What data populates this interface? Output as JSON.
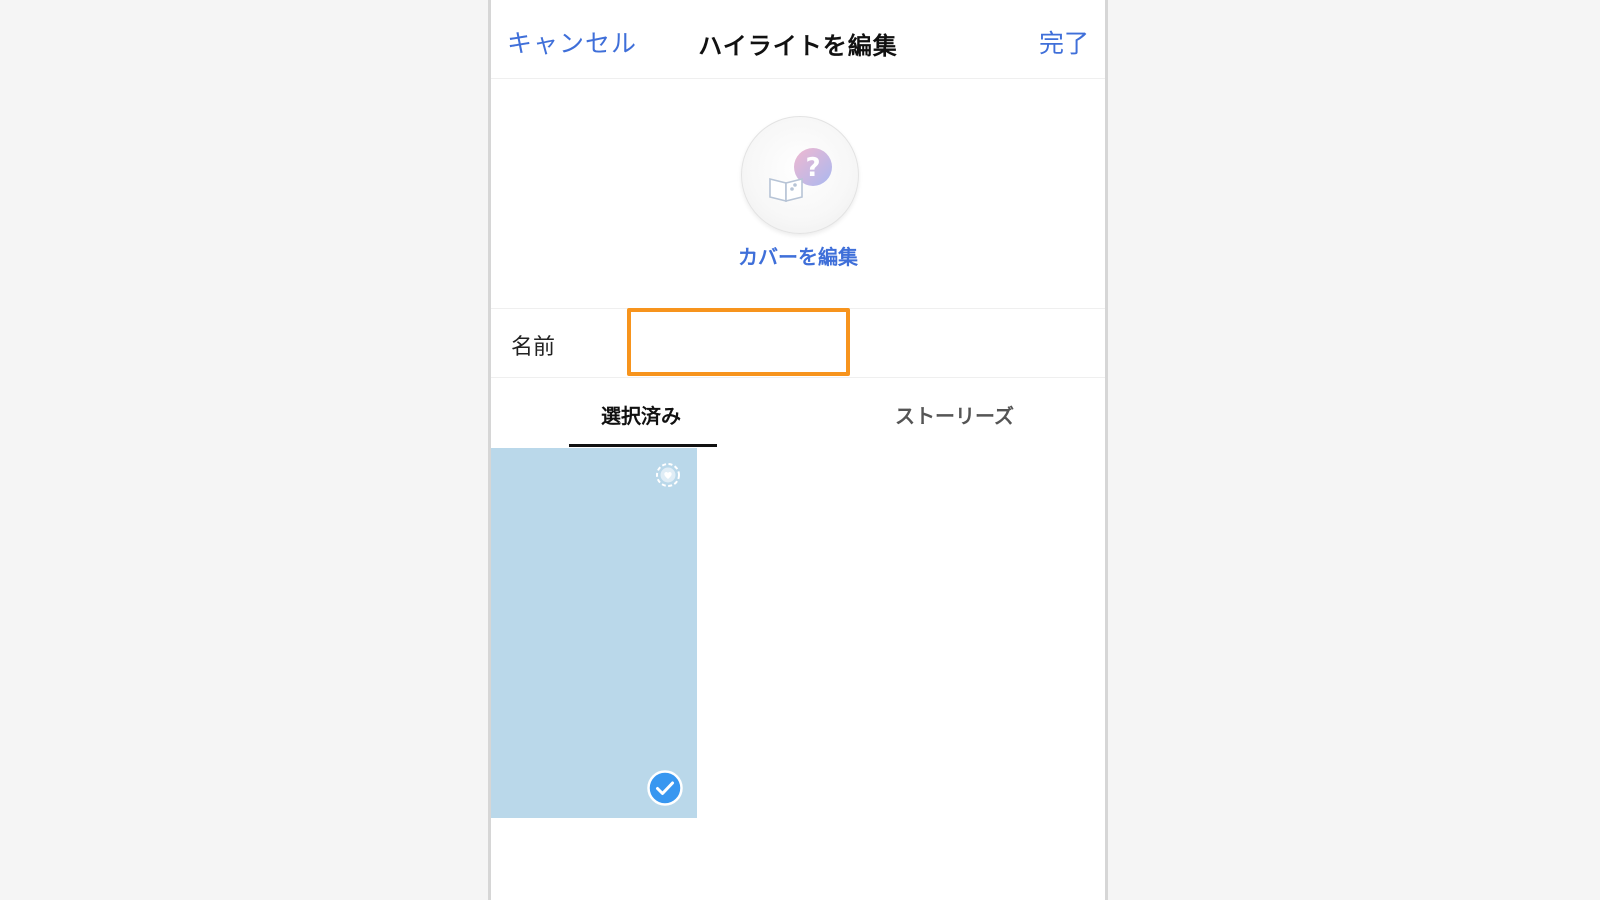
{
  "header": {
    "cancel_label": "キャンセル",
    "title": "ハイライトを編集",
    "done_label": "完了"
  },
  "cover": {
    "edit_label": "カバーを編集",
    "placeholder_icon": "question-book-icon"
  },
  "name_field": {
    "label": "名前",
    "value": "",
    "highlight_color": "#f7941d"
  },
  "tabs": [
    {
      "label": "選択済み",
      "active": true
    },
    {
      "label": "ストーリーズ",
      "active": false
    }
  ],
  "stories": [
    {
      "color": "#bad8ea",
      "selected": true,
      "badge_icon": "heart-icon",
      "check_icon": "checkmark-icon"
    }
  ],
  "colors": {
    "accent": "#3f6fd9",
    "check_blue": "#3897f0"
  }
}
